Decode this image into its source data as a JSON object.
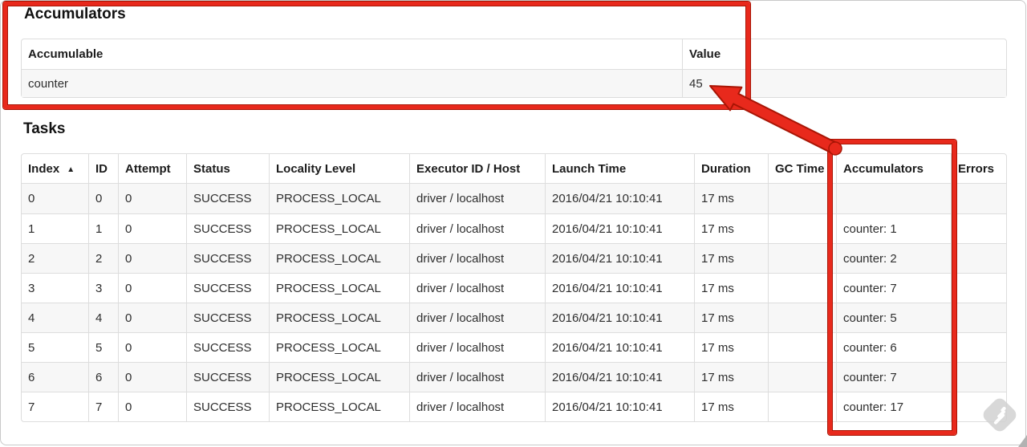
{
  "accumulators": {
    "heading": "Accumulators",
    "table": {
      "headers": {
        "accumulable": "Accumulable",
        "value": "Value"
      },
      "rows": [
        {
          "accumulable": "counter",
          "value": "45"
        }
      ]
    }
  },
  "tasks": {
    "heading": "Tasks",
    "table": {
      "headers": [
        "Index",
        "ID",
        "Attempt",
        "Status",
        "Locality Level",
        "Executor ID / Host",
        "Launch Time",
        "Duration",
        "GC Time",
        "Accumulators",
        "Errors"
      ],
      "sort_indicator": "▲",
      "sorted_column": "Index",
      "rows": [
        [
          "0",
          "0",
          "0",
          "SUCCESS",
          "PROCESS_LOCAL",
          "driver / localhost",
          "2016/04/21 10:10:41",
          "17 ms",
          "",
          "",
          ""
        ],
        [
          "1",
          "1",
          "0",
          "SUCCESS",
          "PROCESS_LOCAL",
          "driver / localhost",
          "2016/04/21 10:10:41",
          "17 ms",
          "",
          "counter: 1",
          ""
        ],
        [
          "2",
          "2",
          "0",
          "SUCCESS",
          "PROCESS_LOCAL",
          "driver / localhost",
          "2016/04/21 10:10:41",
          "17 ms",
          "",
          "counter: 2",
          ""
        ],
        [
          "3",
          "3",
          "0",
          "SUCCESS",
          "PROCESS_LOCAL",
          "driver / localhost",
          "2016/04/21 10:10:41",
          "17 ms",
          "",
          "counter: 7",
          ""
        ],
        [
          "4",
          "4",
          "0",
          "SUCCESS",
          "PROCESS_LOCAL",
          "driver / localhost",
          "2016/04/21 10:10:41",
          "17 ms",
          "",
          "counter: 5",
          ""
        ],
        [
          "5",
          "5",
          "0",
          "SUCCESS",
          "PROCESS_LOCAL",
          "driver / localhost",
          "2016/04/21 10:10:41",
          "17 ms",
          "",
          "counter: 6",
          ""
        ],
        [
          "6",
          "6",
          "0",
          "SUCCESS",
          "PROCESS_LOCAL",
          "driver / localhost",
          "2016/04/21 10:10:41",
          "17 ms",
          "",
          "counter: 7",
          ""
        ],
        [
          "7",
          "7",
          "0",
          "SUCCESS",
          "PROCESS_LOCAL",
          "driver / localhost",
          "2016/04/21 10:10:41",
          "17 ms",
          "",
          "counter: 17",
          ""
        ]
      ]
    }
  },
  "annotations": {
    "highlight_color": "#e8291c"
  }
}
